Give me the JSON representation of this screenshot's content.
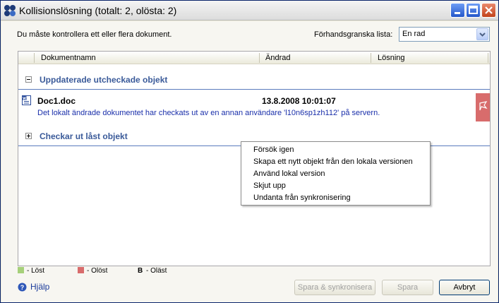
{
  "window": {
    "title": "Kollisionslösning (totalt: 2, olösta: 2)"
  },
  "toolbar": {
    "instruction": "Du måste kontrollera ett eller flera dokument.",
    "preview_label": "Förhandsgranska lista:",
    "preview_value": "En rad"
  },
  "columns": {
    "name": "Dokumentnamn",
    "changed": "Ändrad",
    "solution": "Lösning"
  },
  "groups": [
    {
      "label": "Uppdaterade utcheckade objekt",
      "expanded": true,
      "items": [
        {
          "name": "Doc1.doc",
          "changed": "13.8.2008 10:01:07",
          "message": "Det lokalt ändrade dokumentet har checkats ut av en annan användare 'l10n6sp1zh112' på servern.",
          "status_color": "#d86c6c"
        }
      ]
    },
    {
      "label": "Checkar ut låst objekt",
      "expanded": false
    }
  ],
  "context_menu": {
    "items": [
      "Försök igen",
      "Skapa ett nytt objekt från den lokala versionen",
      "Använd lokal version",
      "Skjut upp",
      "Undanta från synkronisering"
    ]
  },
  "legend": {
    "resolved": "- Löst",
    "unresolved": "- Olöst",
    "b_key": "B",
    "b_label": "- Oläst",
    "resolved_color": "#a6d07a",
    "unresolved_color": "#d86c6c"
  },
  "footer": {
    "help": "Hjälp",
    "save_sync": "Spara & synkronisera",
    "save": "Spara",
    "cancel": "Avbryt"
  }
}
